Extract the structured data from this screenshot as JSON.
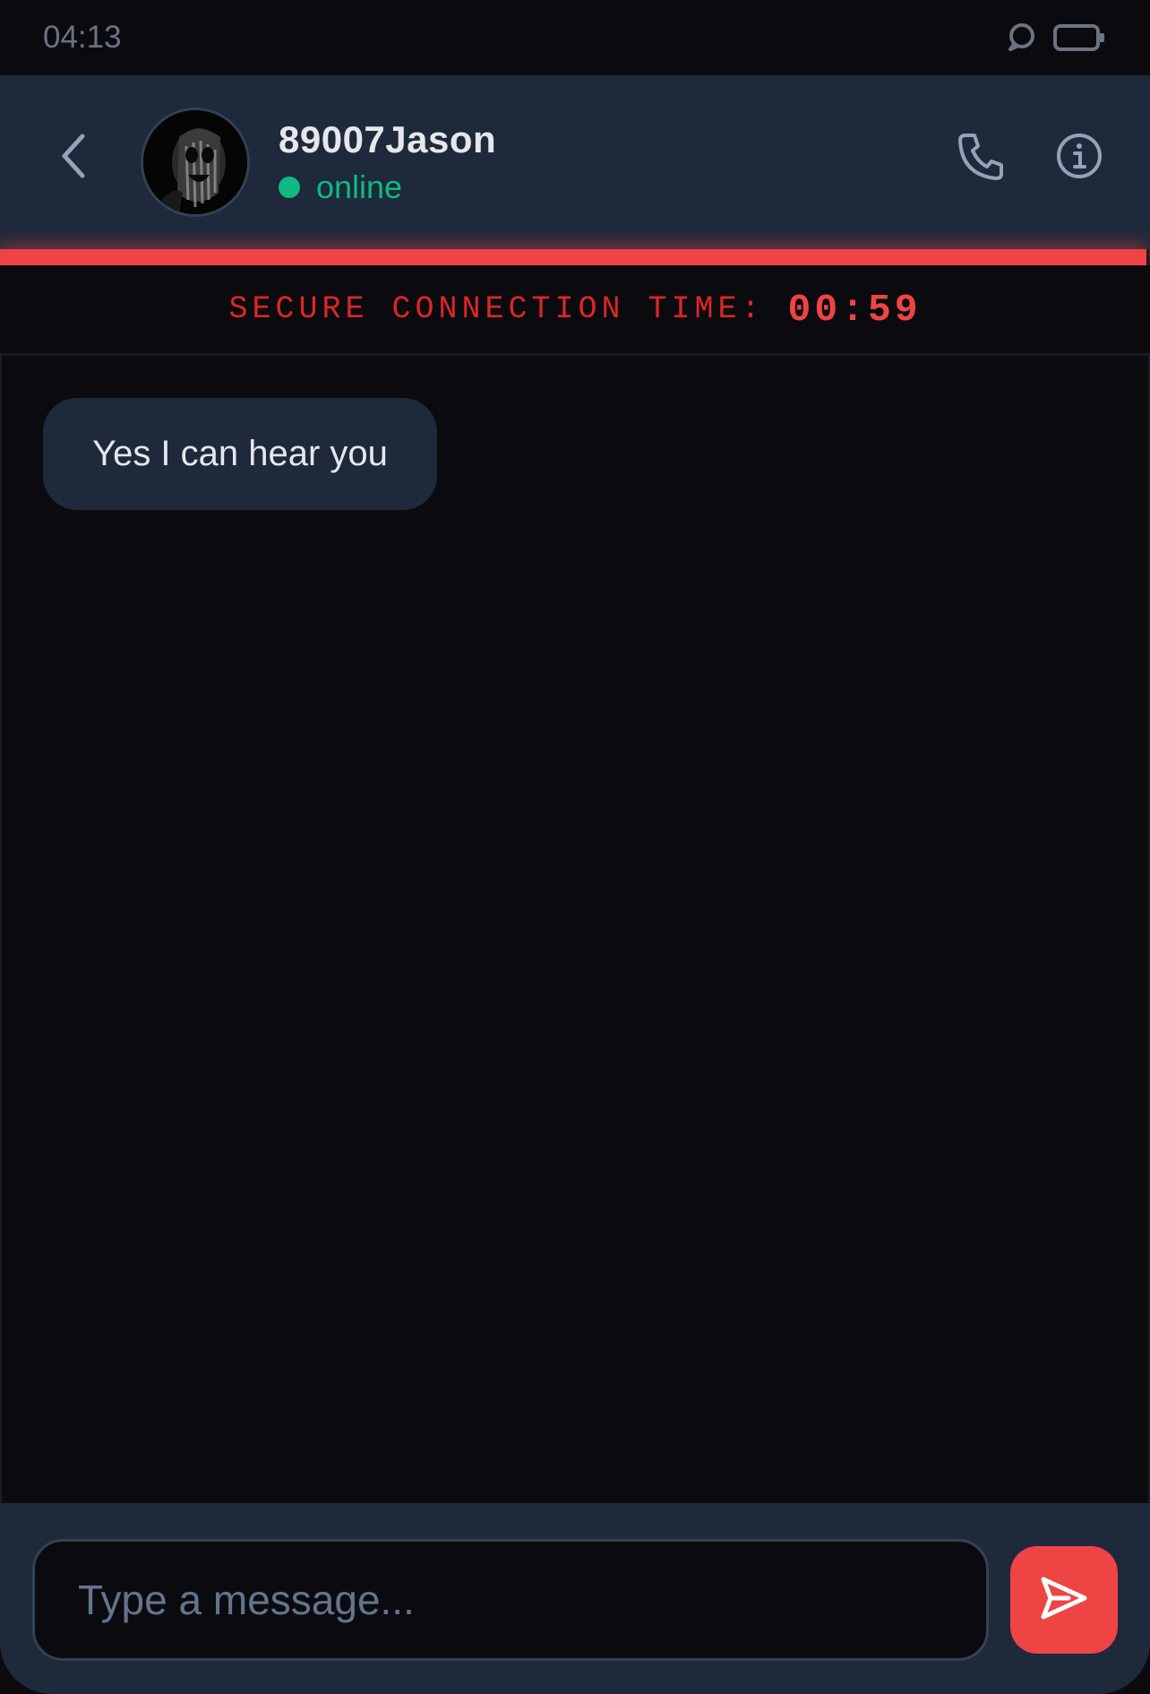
{
  "status_bar": {
    "time": "04:13"
  },
  "header": {
    "contact_name": "89007Jason",
    "presence": "online"
  },
  "secure": {
    "label": "SECURE CONNECTION TIME:",
    "time": "00:59"
  },
  "messages": [
    {
      "direction": "incoming",
      "text": "Yes I can hear you"
    }
  ],
  "composer": {
    "placeholder": "Type a message...",
    "value": ""
  },
  "icons": {
    "back": "chevron-left-icon",
    "call": "phone-icon",
    "info": "info-icon",
    "send": "send-icon",
    "status_chat": "chat-bubble-icon",
    "status_battery": "battery-icon"
  },
  "colors": {
    "accent": "#ef4444",
    "online": "#10b981",
    "header_bg": "#1e293b",
    "page_bg": "#0b0b0f"
  }
}
